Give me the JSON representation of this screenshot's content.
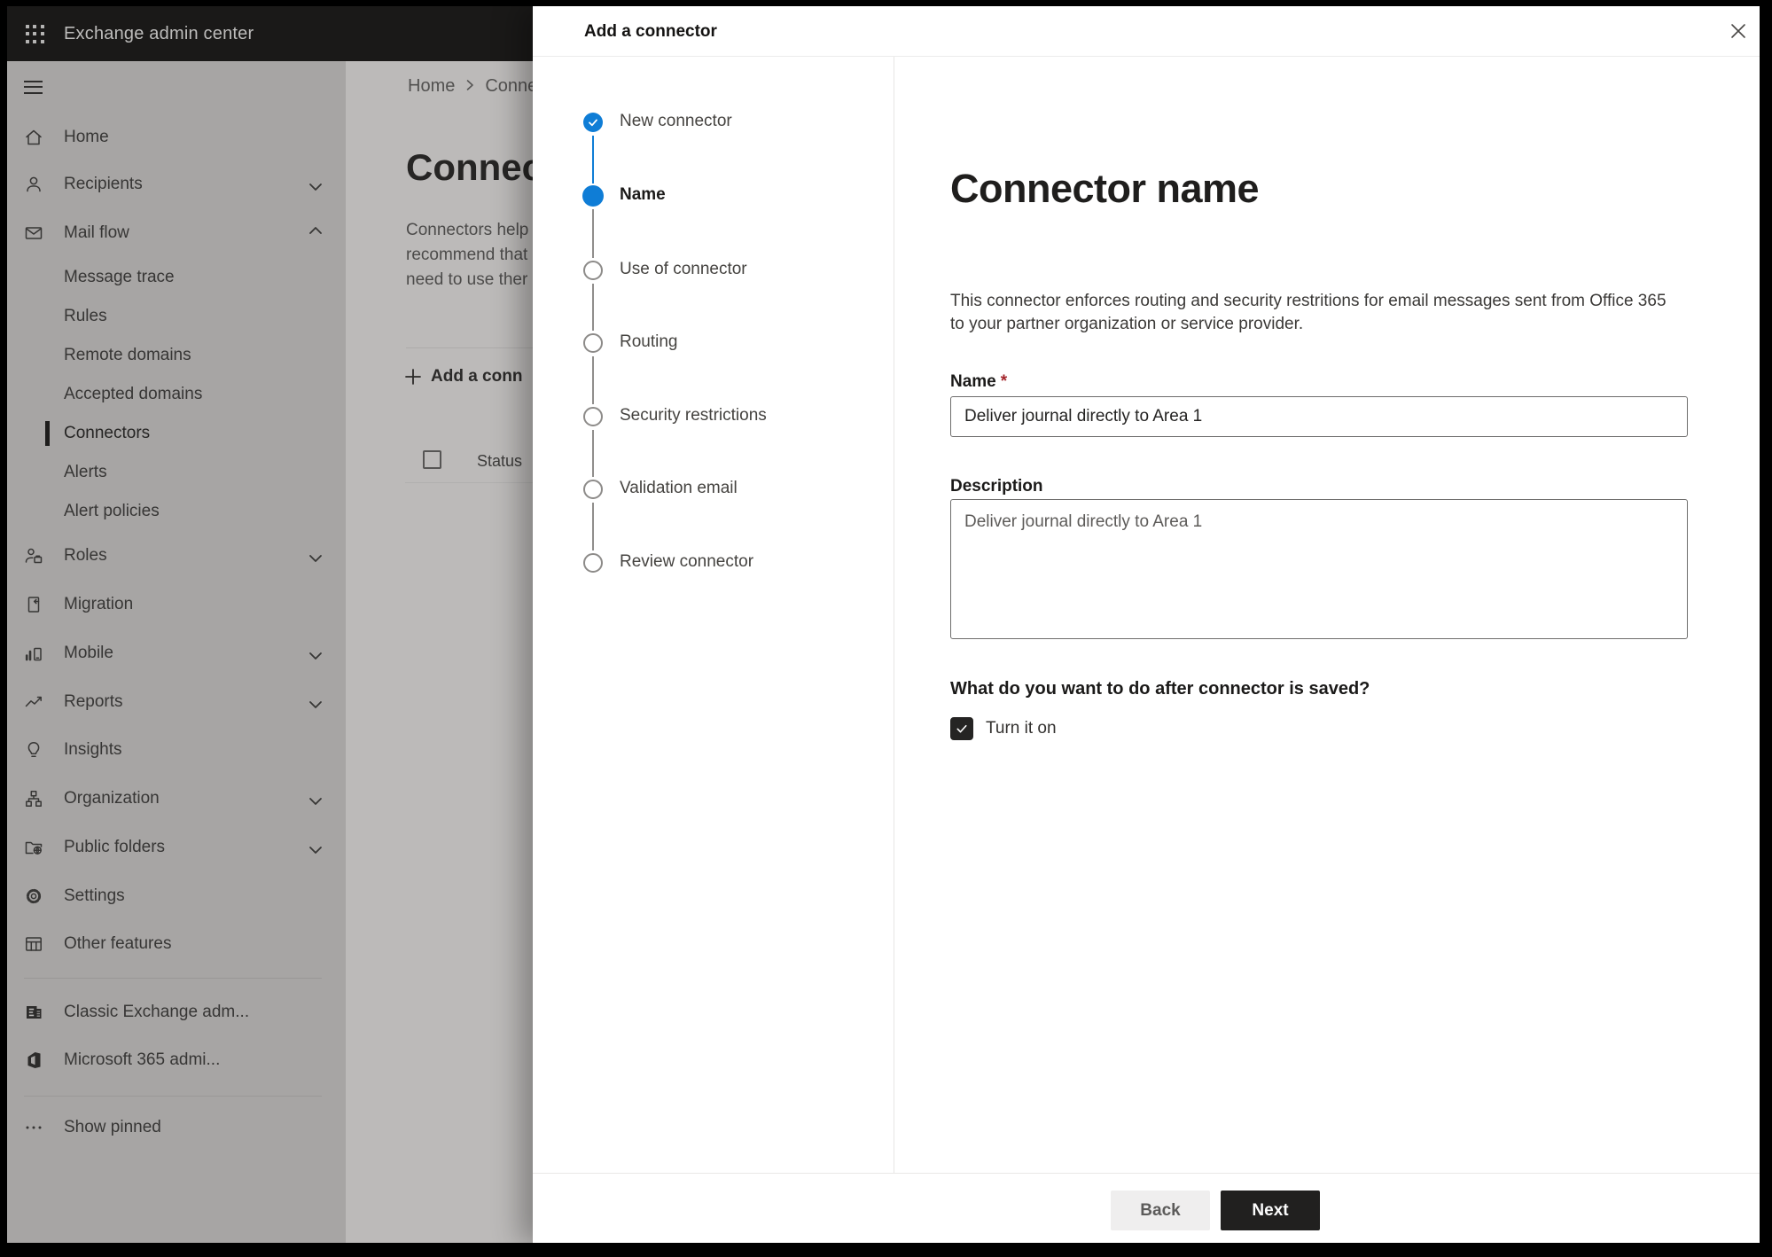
{
  "topbar": {
    "app_title": "Exchange admin center"
  },
  "sidebar": {
    "items": [
      {
        "label": "Home"
      },
      {
        "label": "Recipients",
        "chevron": "down"
      },
      {
        "label": "Mail flow",
        "chevron": "up"
      },
      {
        "label": "Message trace"
      },
      {
        "label": "Rules"
      },
      {
        "label": "Remote domains"
      },
      {
        "label": "Accepted domains"
      },
      {
        "label": "Connectors",
        "selected": true
      },
      {
        "label": "Alerts"
      },
      {
        "label": "Alert policies"
      },
      {
        "label": "Roles",
        "chevron": "down"
      },
      {
        "label": "Migration"
      },
      {
        "label": "Mobile",
        "chevron": "down"
      },
      {
        "label": "Reports",
        "chevron": "down"
      },
      {
        "label": "Insights"
      },
      {
        "label": "Organization",
        "chevron": "down"
      },
      {
        "label": "Public folders",
        "chevron": "down"
      },
      {
        "label": "Settings"
      },
      {
        "label": "Other features"
      }
    ],
    "footer_items": [
      {
        "label": "Classic Exchange adm..."
      },
      {
        "label": "Microsoft 365 admi..."
      }
    ],
    "show_pinned": "Show pinned"
  },
  "page": {
    "breadcrumb": {
      "home": "Home",
      "current": "Conne"
    },
    "title": "Connec",
    "intro_lines": [
      "Connectors help",
      "recommend that",
      "need to use ther"
    ],
    "add_button": "Add a conn",
    "status_header": "Status"
  },
  "dialog": {
    "title": "Add a connector",
    "steps": [
      {
        "label": "New connector",
        "state": "completed"
      },
      {
        "label": "Name",
        "state": "current"
      },
      {
        "label": "Use of connector",
        "state": "upcoming"
      },
      {
        "label": "Routing",
        "state": "upcoming"
      },
      {
        "label": "Security restrictions",
        "state": "upcoming"
      },
      {
        "label": "Validation email",
        "state": "upcoming"
      },
      {
        "label": "Review connector",
        "state": "upcoming"
      }
    ],
    "content": {
      "heading": "Connector name",
      "description_line1": "This connector enforces routing and security restritions for email messages sent from Office 365",
      "description_line2": "to your partner organization or service provider.",
      "name_label": "Name",
      "required_marker": "*",
      "name_value": "Deliver journal directly to Area 1",
      "description_label": "Description",
      "description_value": "Deliver journal directly to Area 1",
      "question": "What do you want to do after connector is saved?",
      "checkbox_label": "Turn it on",
      "checkbox_checked": true
    },
    "footer": {
      "back": "Back",
      "next": "Next"
    }
  },
  "colors": {
    "accent": "#0f7dd6",
    "required": "#a4262c",
    "primary_button": "#21201f",
    "topbar": "#1a1918"
  }
}
